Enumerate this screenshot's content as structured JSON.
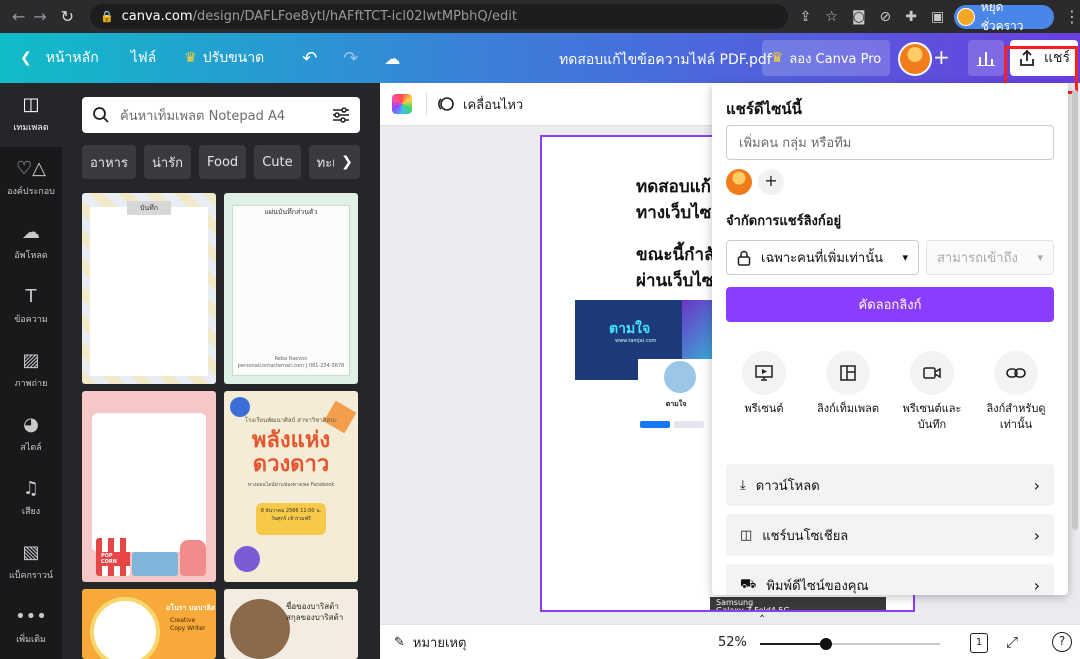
{
  "browser": {
    "url_host": "canva.com",
    "url_path": "/design/DAFLFoe8ytl/hAFftTCT-icl02lwtMPbhQ/edit",
    "profile_label": "หยุดชั่วคราว"
  },
  "header": {
    "home": "หน้าหลัก",
    "file": "ไฟล์",
    "resize": "ปรับขนาด",
    "doc_title": "ทดสอบแก้ไขข้อความไฟล์ PDF.pdf",
    "pro": "ลอง Canva Pro",
    "share": "แชร์"
  },
  "rail": [
    {
      "label": "เทมเพลต",
      "icon": "template-icon"
    },
    {
      "label": "องค์ประกอบ",
      "icon": "elements-icon"
    },
    {
      "label": "อัพโหลด",
      "icon": "upload-icon"
    },
    {
      "label": "ข้อความ",
      "icon": "text-icon"
    },
    {
      "label": "ภาพถ่าย",
      "icon": "photo-icon"
    },
    {
      "label": "สไตล์",
      "icon": "palette-icon"
    },
    {
      "label": "เสียง",
      "icon": "music-icon"
    },
    {
      "label": "แบ็คกราวน์",
      "icon": "background-icon"
    },
    {
      "label": "เพิ่มเติม",
      "icon": "more-icon"
    }
  ],
  "templates": {
    "search_placeholder": "ค้นหาเท็มเพลต Notepad A4",
    "chips": [
      "อาหาร",
      "น่ารัก",
      "Food",
      "Cute",
      "ทะเล",
      "ดอ"
    ],
    "t1_tag": "บันทึก",
    "t2_title": "แผ่นบันทึกส่วนตัว",
    "t2_foot": "Reba Raevon\npersonalcontactemail.com | 081-234-5678",
    "t3_pop": "POP CORN",
    "t4_sub": "โรงเรียนพัฒนาศิลป์ สาขาวิชาศิลปะ",
    "t4_big": "พลังแห่ง\nดวงดาว",
    "t4_small": "ทางออนไลน์ผ่านช่องทางเพจ Facebook",
    "t4_box": "8 ธันวาคม 2566 11:00 น. วันศุกร์ เข้าร่วมฟรี",
    "t5_name": "อโนรา มอนาลิส",
    "t5_role": "Creative\nCopy Writer",
    "t6_name": "ชื่อของบาริสต้า\nสกุลของบาริสต้า"
  },
  "canvas": {
    "animate": "เคลื่อนไหว",
    "line1": "ทดสอบแก้",
    "line2": "ทางเว็บไซต",
    "line3": "ขณะนี้กำลั",
    "line4": "ผ่านเว็บไซต",
    "img_logo": "ตามใจ",
    "img_sub": "www.tamjai.com",
    "fb_name": "ตามใจ",
    "shot_text": "Samsung\nGalaxy Z Fold4 5G"
  },
  "bottom": {
    "notes": "หมายเหตุ",
    "zoom": "52%",
    "zoom_fraction": 0.52,
    "page": "1"
  },
  "share_panel": {
    "title": "แชร์ดีไซน์นี้",
    "people_placeholder": "เพิ่มคน กลุ่ม หรือทีม",
    "link_heading": "จำกัดการแชร์ลิงก์อยู่",
    "access_value": "เฉพาะคนที่เพิ่มเท่านั้น",
    "permission_value": "สามารถเข้าถึง",
    "copy_link": "คัดลอกลิงก์",
    "actions": [
      "พรีเซนต์",
      "ลิงก์เท็มเพลต",
      "พรีเซนต์และ\nบันทึก",
      "ลิงก์สำหรับดู\nเท่านั้น"
    ],
    "rows": [
      "ดาวน์โหลด",
      "แชร์บนโซเชียล",
      "พิมพ์ดีไซน์ของคุณ"
    ]
  },
  "colors": {
    "brand_purple": "#8b3dff",
    "highlight_red": "#ff1f1f"
  }
}
